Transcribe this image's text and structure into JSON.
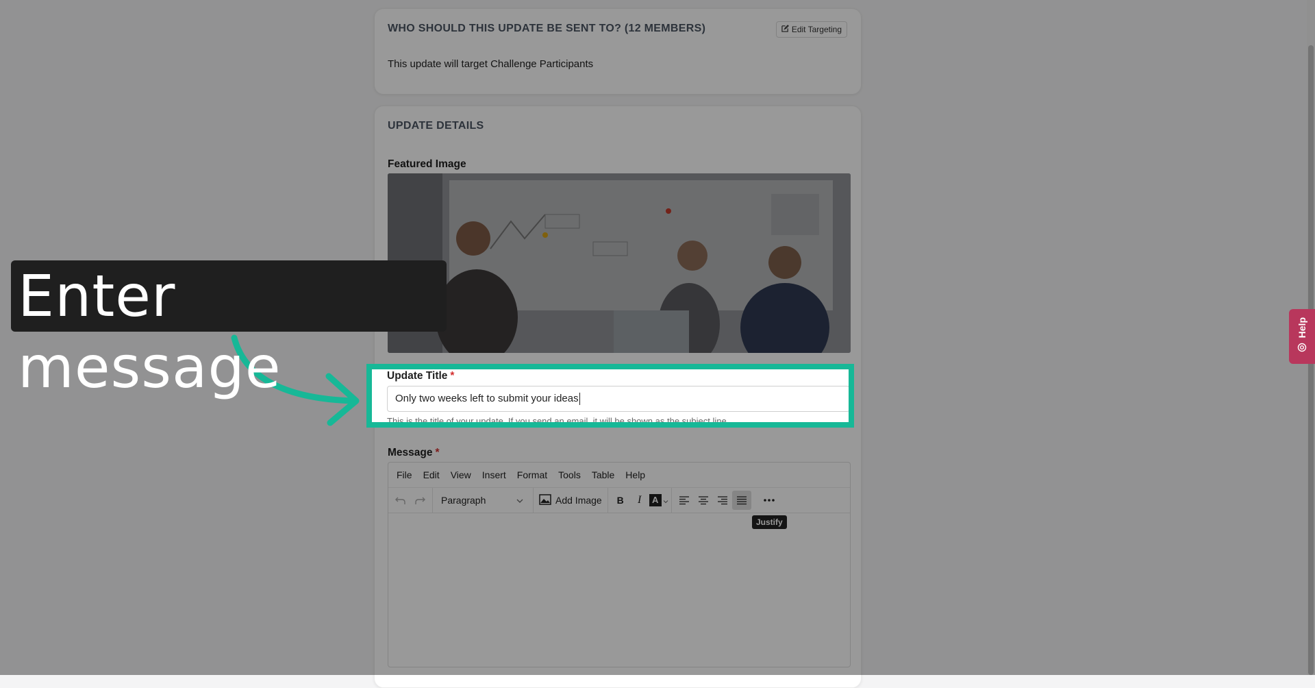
{
  "targeting": {
    "heading": "WHO SHOULD THIS UPDATE BE SENT TO? (12 MEMBERS)",
    "edit_label": "Edit Targeting",
    "summary": "This update will target Challenge Participants"
  },
  "details": {
    "heading": "UPDATE DETAILS",
    "featured_image_label": "Featured Image",
    "title_label": "Update Title",
    "required_mark": "*",
    "title_value": "Only two weeks left to submit your ideas",
    "title_help": "This is the title of your update. If you send an email, it will be shown as the subject line.",
    "message_label": "Message"
  },
  "editor": {
    "menu": [
      "File",
      "Edit",
      "View",
      "Insert",
      "Format",
      "Tools",
      "Table",
      "Help"
    ],
    "block_format": "Paragraph",
    "add_image_label": "Add Image",
    "tooltip": "Justify"
  },
  "callout": {
    "text": "Enter message"
  },
  "help_tab": {
    "label": "Help"
  },
  "colors": {
    "highlight": "#17b897",
    "help_tab": "#b8375c",
    "required": "#d32f2f"
  }
}
